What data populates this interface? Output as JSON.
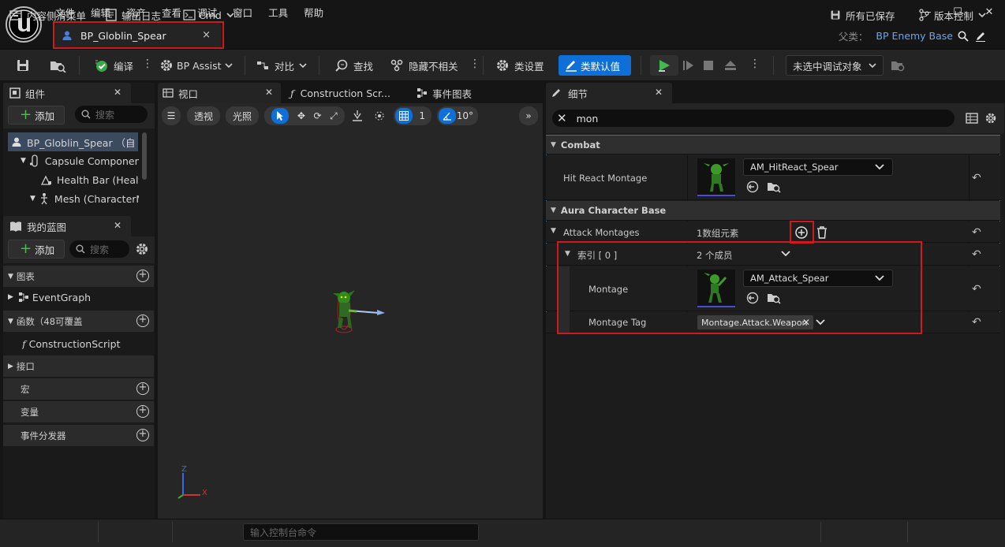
{
  "menu": [
    "文件",
    "编辑",
    "资产",
    "查看",
    "调试",
    "窗口",
    "工具",
    "帮助"
  ],
  "tab": {
    "title": "BP_Globlin_Spear",
    "close": "×"
  },
  "window_controls": {
    "minimize": "—",
    "maximize": "☐",
    "close": "✕"
  },
  "parent": {
    "label": "父类：",
    "value": "BP Enemy Base"
  },
  "toolbar": {
    "compile": "编译",
    "bp_assist": "BP Assist",
    "diff": "对比",
    "find": "查找",
    "hide_unrelated": "隐藏不相关",
    "class_settings": "类设置",
    "class_defaults": "类默认值",
    "debug_target": "未选中调试对象"
  },
  "components_panel": {
    "title": "组件",
    "add": "添加",
    "search_placeholder": "搜索",
    "items": [
      "BP_Globlin_Spear （自",
      "Capsule Component",
      "Health Bar (Health",
      "Mesh (CharacterM"
    ]
  },
  "myblueprint_panel": {
    "title": "我的蓝图",
    "add": "添加",
    "search_placeholder": "搜索",
    "graphs_header": "图表",
    "event_graph": "EventGraph",
    "functions_header": "函数（48可覆盖",
    "construction_script": "ConstructionScript",
    "interfaces_header": "接口",
    "macros_header": "宏",
    "variables_header": "变量",
    "dispatchers_header": "事件分发器"
  },
  "viewport": {
    "tabs": {
      "viewport": "视口",
      "construction": "Construction Scr...",
      "event_graph": "事件图表"
    },
    "perspective": "透视",
    "lit": "光照",
    "grid_value": "1",
    "angle_value": "10°",
    "axis_z": "Z",
    "axis_x": "X"
  },
  "details": {
    "title": "细节",
    "search_value": "mon",
    "combat_header": "Combat",
    "hit_react_label": "Hit React Montage",
    "hit_react_asset": "AM_HitReact_Spear",
    "aura_header": "Aura Character Base",
    "attack_montages_label": "Attack Montages",
    "attack_montages_value": "1数组元素",
    "index_label": "索引 [ 0 ]",
    "index_value": "2 个成员",
    "montage_label": "Montage",
    "montage_asset": "AM_Attack_Spear",
    "montage_tag_label": "Montage Tag",
    "montage_tag_value": "Montage.Attack.Weapon"
  },
  "bottom": {
    "content_drawer": "内容侧滑菜单",
    "output_log": "输出日志",
    "cmd": "Cmd",
    "console_placeholder": "输入控制台命令",
    "all_saved": "所有已保存",
    "source_control": "版本控制"
  },
  "colors": {
    "accent_blue": "#0e6fd8",
    "highlight_red": "#d0181e",
    "link_blue": "#6da3e8",
    "play_green": "#3fb950"
  }
}
